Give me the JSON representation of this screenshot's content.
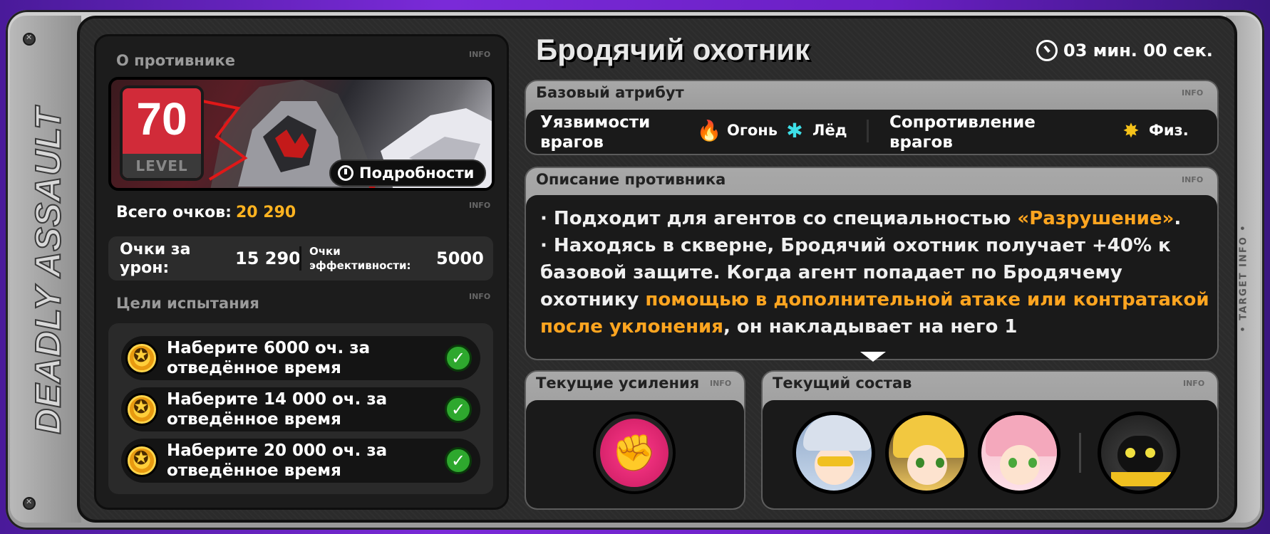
{
  "frame": {
    "side_label": "DEADLY ASSAULT",
    "right_label": "• TARGET INFO •",
    "info_tag": "INFO"
  },
  "enemy": {
    "section_title": "О противнике",
    "level": "70",
    "level_label": "LEVEL",
    "details_button": "Подробности",
    "name": "Бродячий охотник"
  },
  "score": {
    "total_label": "Всего очков:",
    "total_value": "20 290",
    "damage_label": "Очки за урон:",
    "damage_value": "15 290",
    "efficiency_label": "Очки эффективности:",
    "efficiency_value": "5000"
  },
  "goals": {
    "section_title": "Цели испытания",
    "items": [
      {
        "text": "Наберите 6000 оч. за отведённое время",
        "done": true
      },
      {
        "text": "Наберите 14 000 оч. за отведённое время",
        "done": true
      },
      {
        "text": "Наберите 20 000 оч. за отведённое время",
        "done": true
      }
    ]
  },
  "timer": "03 мин. 00 сек.",
  "attribute": {
    "header": "Базовый атрибут",
    "weakness_label": "Уязвимости врагов",
    "weak_1": "Огонь",
    "weak_1_icon": "fire-icon",
    "weak_2": "Лёд",
    "weak_2_icon": "ice-icon",
    "resist_label": "Сопротивление врагов",
    "resist_1": "Физ.",
    "resist_1_icon": "physical-icon"
  },
  "description": {
    "header": "Описание противника",
    "line1_a": "· Подходит для агентов со специальностью ",
    "line1_hl": "«Разрушение»",
    "line1_b": ".",
    "line2_a": "· Находясь в скверне, Бродячий охотник получает +40% к базовой защите. Когда агент попадает по Бродячему охотнику ",
    "line2_hl": "помощью в дополнительной атаке или контратакой после уклонения",
    "line2_b": ", он накладывает на него 1"
  },
  "buffs": {
    "header": "Текущие усиления",
    "icon": "fist-buff-icon"
  },
  "team": {
    "header": "Текущий состав",
    "agents": [
      "agent-1-avatar",
      "agent-2-avatar",
      "agent-3-avatar",
      "bangboo-avatar"
    ]
  },
  "colors": {
    "accent": "#ffa520",
    "level_bg": "#d12b39",
    "check": "#2ea82e",
    "buff": "#e8246f"
  }
}
